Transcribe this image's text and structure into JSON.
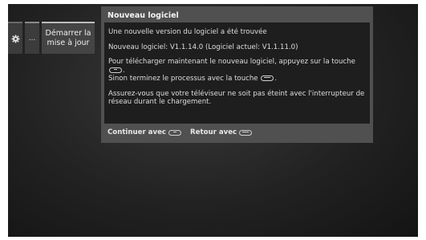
{
  "menu": {
    "settings_icon": "gear-icon",
    "more_label": "...",
    "action_label_line1": "Démarrer la",
    "action_label_line2": "mise à jour"
  },
  "dialog": {
    "title": "Nouveau logiciel",
    "line_found": "Une nouvelle version du logiciel a été trouvée",
    "line_version": "Nouveau logiciel:  V1.1.14.0   (Logiciel actuel:  V1.1.11.0)",
    "line_download_a": "Pour télécharger maintenant le nouveau logiciel, appuyez sur la touche",
    "line_download_b": "Sinon terminez le processus avec la touche",
    "line_warning": "Assurez-vous que votre téléviseur ne soit pas éteint avec l'interrupteur de réseau durant le chargement.",
    "footer_continue": "Continuer avec",
    "footer_back": "Retour avec",
    "key_ok_icon": "ok-key-icon",
    "key_exit_icon": "exit-key-icon"
  }
}
